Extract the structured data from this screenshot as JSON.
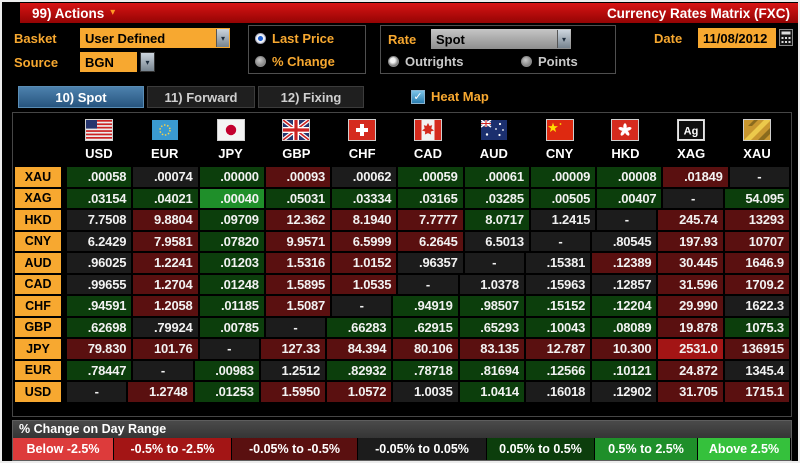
{
  "titlebar": {
    "actions_label": "99) Actions",
    "title": "Currency Rates Matrix (FXC)"
  },
  "controls": {
    "basket_label": "Basket",
    "basket_value": "User Defined",
    "source_label": "Source",
    "source_value": "BGN",
    "price_options": [
      "Last Price",
      "% Change"
    ],
    "price_selected": "Last Price",
    "rate_label": "Rate",
    "rate_value": "Spot",
    "rate_options": [
      "Outrights",
      "Points"
    ],
    "rate_selected": "Outrights",
    "date_label": "Date",
    "date_value": "11/08/2012"
  },
  "tabs": [
    {
      "label": "10) Spot",
      "selected": true
    },
    {
      "label": "11) Forward",
      "selected": false
    },
    {
      "label": "12) Fixing",
      "selected": false
    }
  ],
  "heatmap_checkbox": {
    "label": "Heat Map",
    "checked": true
  },
  "heat_colors": {
    "dn3": "#dd3b3b",
    "dn2": "#a31515",
    "dn1": "#5a1010",
    "flat": "#1c1c1c",
    "up1": "#0c3e0c",
    "up2": "#1f8f2a",
    "up3": "#35c13c"
  },
  "colors": {
    "amber_accent": "#f7a830",
    "titlebar_red": "#c40a0a",
    "tab_selected_blue": "#3a6d99"
  },
  "matrix": {
    "columns": [
      {
        "code": "USD",
        "flag": "us"
      },
      {
        "code": "EUR",
        "flag": "eu"
      },
      {
        "code": "JPY",
        "flag": "jp"
      },
      {
        "code": "GBP",
        "flag": "gb"
      },
      {
        "code": "CHF",
        "flag": "ch"
      },
      {
        "code": "CAD",
        "flag": "ca"
      },
      {
        "code": "AUD",
        "flag": "au"
      },
      {
        "code": "CNY",
        "flag": "cn"
      },
      {
        "code": "HKD",
        "flag": "hk"
      },
      {
        "code": "XAG",
        "flag": "ag"
      },
      {
        "code": "XAU",
        "flag": "gold"
      }
    ],
    "rows": [
      {
        "label": "XAU",
        "cells": [
          {
            "v": ".00058",
            "c": "up1"
          },
          {
            "v": ".00074",
            "c": "flat"
          },
          {
            "v": ".00000",
            "c": "up1"
          },
          {
            "v": ".00093",
            "c": "dn1"
          },
          {
            "v": ".00062",
            "c": "flat"
          },
          {
            "v": ".00059",
            "c": "up1"
          },
          {
            "v": ".00061",
            "c": "up1"
          },
          {
            "v": ".00009",
            "c": "up1"
          },
          {
            "v": ".00008",
            "c": "up1"
          },
          {
            "v": ".01849",
            "c": "dn1"
          },
          {
            "v": "-",
            "c": "flat"
          }
        ]
      },
      {
        "label": "XAG",
        "cells": [
          {
            "v": ".03154",
            "c": "up1"
          },
          {
            "v": ".04021",
            "c": "up1"
          },
          {
            "v": ".00040",
            "c": "up2"
          },
          {
            "v": ".05031",
            "c": "up1"
          },
          {
            "v": ".03334",
            "c": "up1"
          },
          {
            "v": ".03165",
            "c": "up1"
          },
          {
            "v": ".03285",
            "c": "up1"
          },
          {
            "v": ".00505",
            "c": "up1"
          },
          {
            "v": ".00407",
            "c": "up1"
          },
          {
            "v": "-",
            "c": "flat"
          },
          {
            "v": "54.095",
            "c": "up1"
          }
        ]
      },
      {
        "label": "HKD",
        "cells": [
          {
            "v": "7.7508",
            "c": "flat"
          },
          {
            "v": "9.8804",
            "c": "dn1"
          },
          {
            "v": ".09709",
            "c": "up1"
          },
          {
            "v": "12.362",
            "c": "dn1"
          },
          {
            "v": "8.1940",
            "c": "dn1"
          },
          {
            "v": "7.7777",
            "c": "dn1"
          },
          {
            "v": "8.0717",
            "c": "up1"
          },
          {
            "v": "1.2415",
            "c": "flat"
          },
          {
            "v": "-",
            "c": "flat"
          },
          {
            "v": "245.74",
            "c": "dn1"
          },
          {
            "v": "13293",
            "c": "dn1"
          }
        ]
      },
      {
        "label": "CNY",
        "cells": [
          {
            "v": "6.2429",
            "c": "flat"
          },
          {
            "v": "7.9581",
            "c": "dn1"
          },
          {
            "v": ".07820",
            "c": "up1"
          },
          {
            "v": "9.9571",
            "c": "dn1"
          },
          {
            "v": "6.5999",
            "c": "dn1"
          },
          {
            "v": "6.2645",
            "c": "dn1"
          },
          {
            "v": "6.5013",
            "c": "flat"
          },
          {
            "v": "-",
            "c": "flat"
          },
          {
            "v": ".80545",
            "c": "flat"
          },
          {
            "v": "197.93",
            "c": "dn1"
          },
          {
            "v": "10707",
            "c": "dn1"
          }
        ]
      },
      {
        "label": "AUD",
        "cells": [
          {
            "v": ".96025",
            "c": "flat"
          },
          {
            "v": "1.2241",
            "c": "dn1"
          },
          {
            "v": ".01203",
            "c": "up1"
          },
          {
            "v": "1.5316",
            "c": "dn1"
          },
          {
            "v": "1.0152",
            "c": "dn1"
          },
          {
            "v": ".96357",
            "c": "flat"
          },
          {
            "v": "-",
            "c": "flat"
          },
          {
            "v": ".15381",
            "c": "flat"
          },
          {
            "v": ".12389",
            "c": "dn1"
          },
          {
            "v": "30.445",
            "c": "dn1"
          },
          {
            "v": "1646.9",
            "c": "dn1"
          }
        ]
      },
      {
        "label": "CAD",
        "cells": [
          {
            "v": ".99655",
            "c": "flat"
          },
          {
            "v": "1.2704",
            "c": "dn1"
          },
          {
            "v": ".01248",
            "c": "up1"
          },
          {
            "v": "1.5895",
            "c": "dn1"
          },
          {
            "v": "1.0535",
            "c": "dn1"
          },
          {
            "v": "-",
            "c": "flat"
          },
          {
            "v": "1.0378",
            "c": "flat"
          },
          {
            "v": ".15963",
            "c": "flat"
          },
          {
            "v": ".12857",
            "c": "flat"
          },
          {
            "v": "31.596",
            "c": "dn1"
          },
          {
            "v": "1709.2",
            "c": "dn1"
          }
        ]
      },
      {
        "label": "CHF",
        "cells": [
          {
            "v": ".94591",
            "c": "up1"
          },
          {
            "v": "1.2058",
            "c": "dn1"
          },
          {
            "v": ".01185",
            "c": "up1"
          },
          {
            "v": "1.5087",
            "c": "dn1"
          },
          {
            "v": "-",
            "c": "flat"
          },
          {
            "v": ".94919",
            "c": "up1"
          },
          {
            "v": ".98507",
            "c": "up1"
          },
          {
            "v": ".15152",
            "c": "up1"
          },
          {
            "v": ".12204",
            "c": "up1"
          },
          {
            "v": "29.990",
            "c": "dn1"
          },
          {
            "v": "1622.3",
            "c": "flat"
          }
        ]
      },
      {
        "label": "GBP",
        "cells": [
          {
            "v": ".62698",
            "c": "up1"
          },
          {
            "v": ".79924",
            "c": "flat"
          },
          {
            "v": ".00785",
            "c": "up1"
          },
          {
            "v": "-",
            "c": "flat"
          },
          {
            "v": ".66283",
            "c": "up1"
          },
          {
            "v": ".62915",
            "c": "up1"
          },
          {
            "v": ".65293",
            "c": "up1"
          },
          {
            "v": ".10043",
            "c": "up1"
          },
          {
            "v": ".08089",
            "c": "up1"
          },
          {
            "v": "19.878",
            "c": "dn1"
          },
          {
            "v": "1075.3",
            "c": "up1"
          }
        ]
      },
      {
        "label": "JPY",
        "cells": [
          {
            "v": "79.830",
            "c": "dn1"
          },
          {
            "v": "101.76",
            "c": "dn1"
          },
          {
            "v": "-",
            "c": "flat"
          },
          {
            "v": "127.33",
            "c": "dn1"
          },
          {
            "v": "84.394",
            "c": "dn1"
          },
          {
            "v": "80.106",
            "c": "dn1"
          },
          {
            "v": "83.135",
            "c": "dn1"
          },
          {
            "v": "12.787",
            "c": "dn1"
          },
          {
            "v": "10.300",
            "c": "dn1"
          },
          {
            "v": "2531.0",
            "c": "dn2"
          },
          {
            "v": "136915",
            "c": "dn1"
          }
        ]
      },
      {
        "label": "EUR",
        "cells": [
          {
            "v": ".78447",
            "c": "up1"
          },
          {
            "v": "-",
            "c": "flat"
          },
          {
            "v": ".00983",
            "c": "up1"
          },
          {
            "v": "1.2512",
            "c": "flat"
          },
          {
            "v": ".82932",
            "c": "up1"
          },
          {
            "v": ".78718",
            "c": "up1"
          },
          {
            "v": ".81694",
            "c": "up1"
          },
          {
            "v": ".12566",
            "c": "up1"
          },
          {
            "v": ".10121",
            "c": "up1"
          },
          {
            "v": "24.872",
            "c": "dn1"
          },
          {
            "v": "1345.4",
            "c": "flat"
          }
        ]
      },
      {
        "label": "USD",
        "cells": [
          {
            "v": "-",
            "c": "flat"
          },
          {
            "v": "1.2748",
            "c": "dn1"
          },
          {
            "v": ".01253",
            "c": "up1"
          },
          {
            "v": "1.5950",
            "c": "dn1"
          },
          {
            "v": "1.0572",
            "c": "dn1"
          },
          {
            "v": "1.0035",
            "c": "flat"
          },
          {
            "v": "1.0414",
            "c": "up1"
          },
          {
            "v": ".16018",
            "c": "flat"
          },
          {
            "v": ".12902",
            "c": "flat"
          },
          {
            "v": "31.705",
            "c": "dn1"
          },
          {
            "v": "1715.1",
            "c": "dn1"
          }
        ]
      }
    ]
  },
  "legend": {
    "title": "% Change on Day Range",
    "bins": [
      {
        "label": "Below -2.5%",
        "color": "#dd3b3b"
      },
      {
        "label": "-0.5% to -2.5%",
        "color": "#a31515"
      },
      {
        "label": "-0.05% to -0.5%",
        "color": "#5a1010"
      },
      {
        "label": "-0.05% to 0.05%",
        "color": "#1c1c1c"
      },
      {
        "label": "0.05% to 0.5%",
        "color": "#0c3e0c"
      },
      {
        "label": "0.5% to 2.5%",
        "color": "#1f8f2a"
      },
      {
        "label": "Above 2.5%",
        "color": "#35c13c"
      }
    ]
  }
}
